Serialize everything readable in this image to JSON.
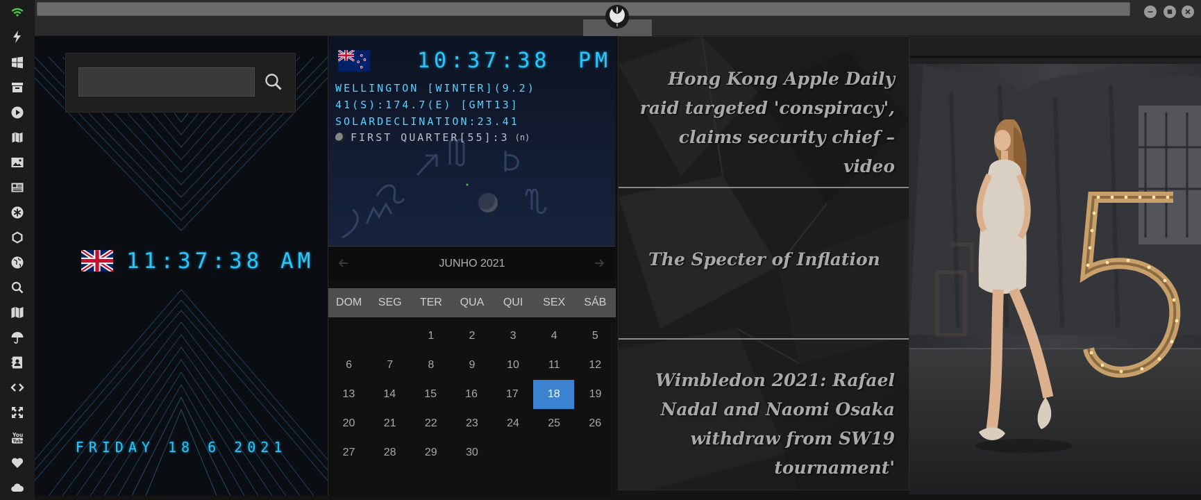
{
  "sidebar": {
    "items": [
      {
        "icon": "wifi-icon",
        "color": "#4cc84c"
      },
      {
        "icon": "lightning-icon"
      },
      {
        "icon": "windows-icon"
      },
      {
        "icon": "archive-icon"
      },
      {
        "icon": "play-icon"
      },
      {
        "icon": "map-book-icon"
      },
      {
        "icon": "image-icon"
      },
      {
        "icon": "news-icon"
      },
      {
        "icon": "asterisk-icon"
      },
      {
        "icon": "hexagon-icon"
      },
      {
        "icon": "globe-icon"
      },
      {
        "icon": "search-icon"
      },
      {
        "icon": "map-icon"
      },
      {
        "icon": "umbrella-icon"
      },
      {
        "icon": "contacts-icon"
      },
      {
        "icon": "code-icon"
      },
      {
        "icon": "expand-icon"
      },
      {
        "icon": "youtube-icon"
      },
      {
        "icon": "heart-icon"
      },
      {
        "icon": "cloud-icon"
      }
    ]
  },
  "window": {
    "logo_icon": "rebel-alliance-icon"
  },
  "clock": {
    "search_placeholder": "",
    "time": "11:37:38 AM",
    "date": "FRIDAY 18 6 2021",
    "flag_icon": "uk-flag-icon"
  },
  "astro": {
    "flag_icon": "nz-flag-icon",
    "time": "10:37:38",
    "ampm": "PM",
    "line1": "WELLINGTON [WINTER](9.2)",
    "line2": "41(S):174.7(E) [GMT13]",
    "line3": "SOLARDECLINATION:23.41",
    "moon_phase": "FIRST QUARTER[55]:3",
    "moon_phase_suffix": "(n)"
  },
  "calendar": {
    "title": "JUNHO 2021",
    "weekdays": [
      "DOM",
      "SEG",
      "TER",
      "QUA",
      "QUI",
      "SEX",
      "SÁB"
    ],
    "weeks": [
      [
        "",
        "",
        "1",
        "2",
        "3",
        "4",
        "5"
      ],
      [
        "6",
        "7",
        "8",
        "9",
        "10",
        "11",
        "12"
      ],
      [
        "13",
        "14",
        "15",
        "16",
        "17",
        "18",
        "19"
      ],
      [
        "20",
        "21",
        "22",
        "23",
        "24",
        "25",
        "26"
      ],
      [
        "27",
        "28",
        "29",
        "30",
        "",
        "",
        ""
      ]
    ],
    "today": "18",
    "accent": "#3b82d0"
  },
  "news": [
    {
      "headline": "Hong Kong Apple Daily raid targeted 'conspiracy', claims security chief – video"
    },
    {
      "headline": "The Specter of Inflation"
    },
    {
      "headline": "Wimbledon 2021: Rafael Nadal and Naomi Osaka withdraw from SW19 tournament'"
    }
  ],
  "photo": {
    "digit": "5"
  }
}
